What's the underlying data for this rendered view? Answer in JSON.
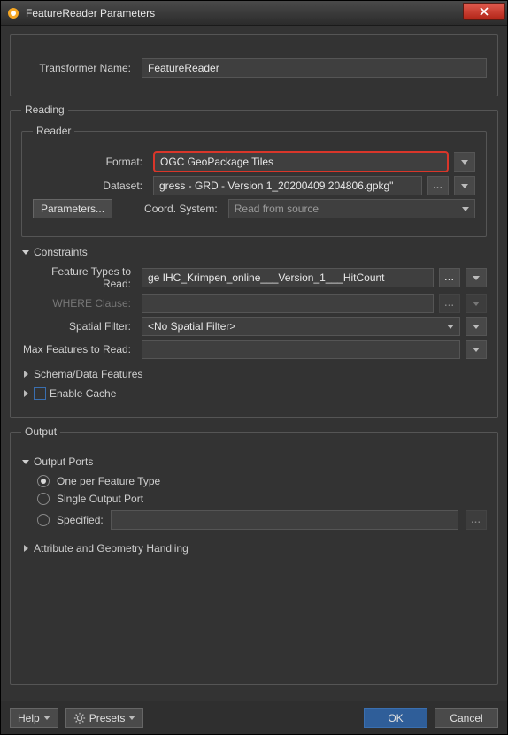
{
  "window": {
    "title": "FeatureReader Parameters",
    "close_tooltip": "Close"
  },
  "transformer": {
    "label": "Transformer Name:",
    "value": "FeatureReader"
  },
  "reading": {
    "legend": "Reading",
    "reader_legend": "Reader",
    "format": {
      "label": "Format:",
      "value": "OGC GeoPackage Tiles"
    },
    "dataset": {
      "label": "Dataset:",
      "value": "gress - GRD - Version 1_20200409 204806.gpkg\""
    },
    "parameters_btn": "Parameters...",
    "coord": {
      "label": "Coord. System:",
      "value": "Read from source"
    },
    "constraints": {
      "header": "Constraints",
      "feature_types": {
        "label": "Feature Types to Read:",
        "value": "ge IHC_Krimpen_online___Version_1___HitCount"
      },
      "where": {
        "label": "WHERE Clause:",
        "value": ""
      },
      "spatial_filter": {
        "label": "Spatial Filter:",
        "value": "<No Spatial Filter>"
      },
      "max_features": {
        "label": "Max Features to Read:",
        "value": ""
      }
    },
    "schema_header": "Schema/Data Features",
    "enable_cache": {
      "label": "Enable Cache"
    }
  },
  "output": {
    "legend": "Output",
    "ports_header": "Output Ports",
    "ports": {
      "one_per": "One per Feature Type",
      "single": "Single Output Port",
      "specified": "Specified:"
    },
    "attr_geom_header": "Attribute and Geometry Handling"
  },
  "footer": {
    "help": "Help",
    "presets": "Presets",
    "ok": "OK",
    "cancel": "Cancel"
  }
}
